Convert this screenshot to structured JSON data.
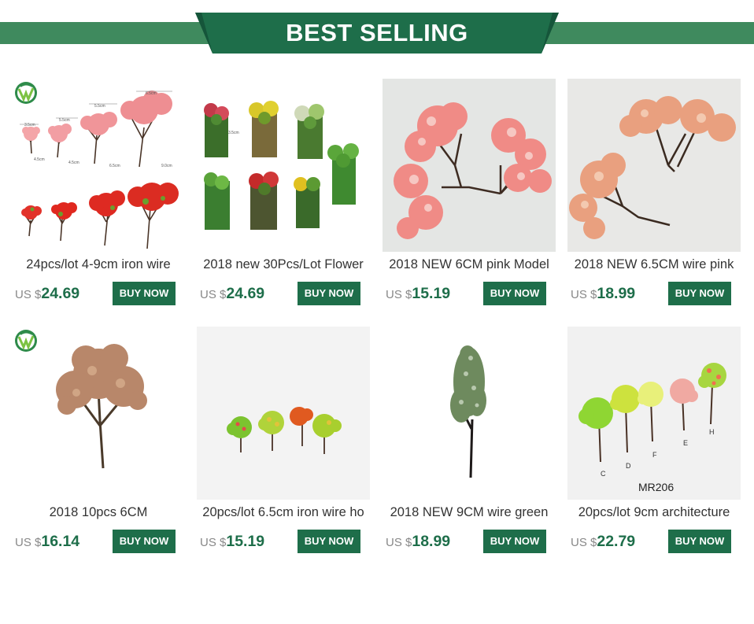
{
  "banner": {
    "title": "BEST SELLING"
  },
  "colors": {
    "brand_green": "#1e6e4a",
    "band_green": "#3f8a5e"
  },
  "products": [
    {
      "title": "24pcs/lot 4-9cm iron wire",
      "currency": "US $",
      "price": "24.69",
      "button": "BUY NOW",
      "image": "pink-red-tree-sizes-photo",
      "has_logo": true,
      "measure_labels": [
        "3.5cm",
        "4.5cm",
        "5.5cm",
        "6.5cm",
        "4.5cm",
        "5.5cm",
        "6.5cm",
        "9.0cm"
      ]
    },
    {
      "title": "2018 new 30Pcs/Lot Flower",
      "currency": "US $",
      "price": "24.69",
      "button": "BUY NOW",
      "image": "flower-bushes-photo",
      "has_logo": false,
      "measure_labels": [
        "3.5cm"
      ]
    },
    {
      "title": "2018 NEW 6CM pink Model",
      "currency": "US $",
      "price": "15.19",
      "button": "BUY NOW",
      "image": "pink-tree-photo",
      "has_logo": false
    },
    {
      "title": "2018 NEW 6.5CM wire pink",
      "currency": "US $",
      "price": "18.99",
      "button": "BUY NOW",
      "image": "peach-tree-photo",
      "has_logo": false
    },
    {
      "title": "2018 10pcs 6CM",
      "currency": "US $",
      "price": "16.14",
      "button": "BUY NOW",
      "image": "brown-tree-photo",
      "has_logo": true
    },
    {
      "title": "20pcs/lot 6.5cm iron wire ho",
      "currency": "US $",
      "price": "15.19",
      "button": "BUY NOW",
      "image": "four-small-trees-photo",
      "has_logo": false
    },
    {
      "title": "2018 NEW 9CM wire green",
      "currency": "US $",
      "price": "18.99",
      "button": "BUY NOW",
      "image": "tall-green-tree-photo",
      "has_logo": false
    },
    {
      "title": "20pcs/lot 9cm architecture",
      "currency": "US $",
      "price": "22.79",
      "button": "BUY NOW",
      "image": "five-colored-trees-photo",
      "has_logo": false,
      "model_code": "MR206",
      "letters": [
        "C",
        "D",
        "F",
        "E",
        "H"
      ]
    }
  ]
}
